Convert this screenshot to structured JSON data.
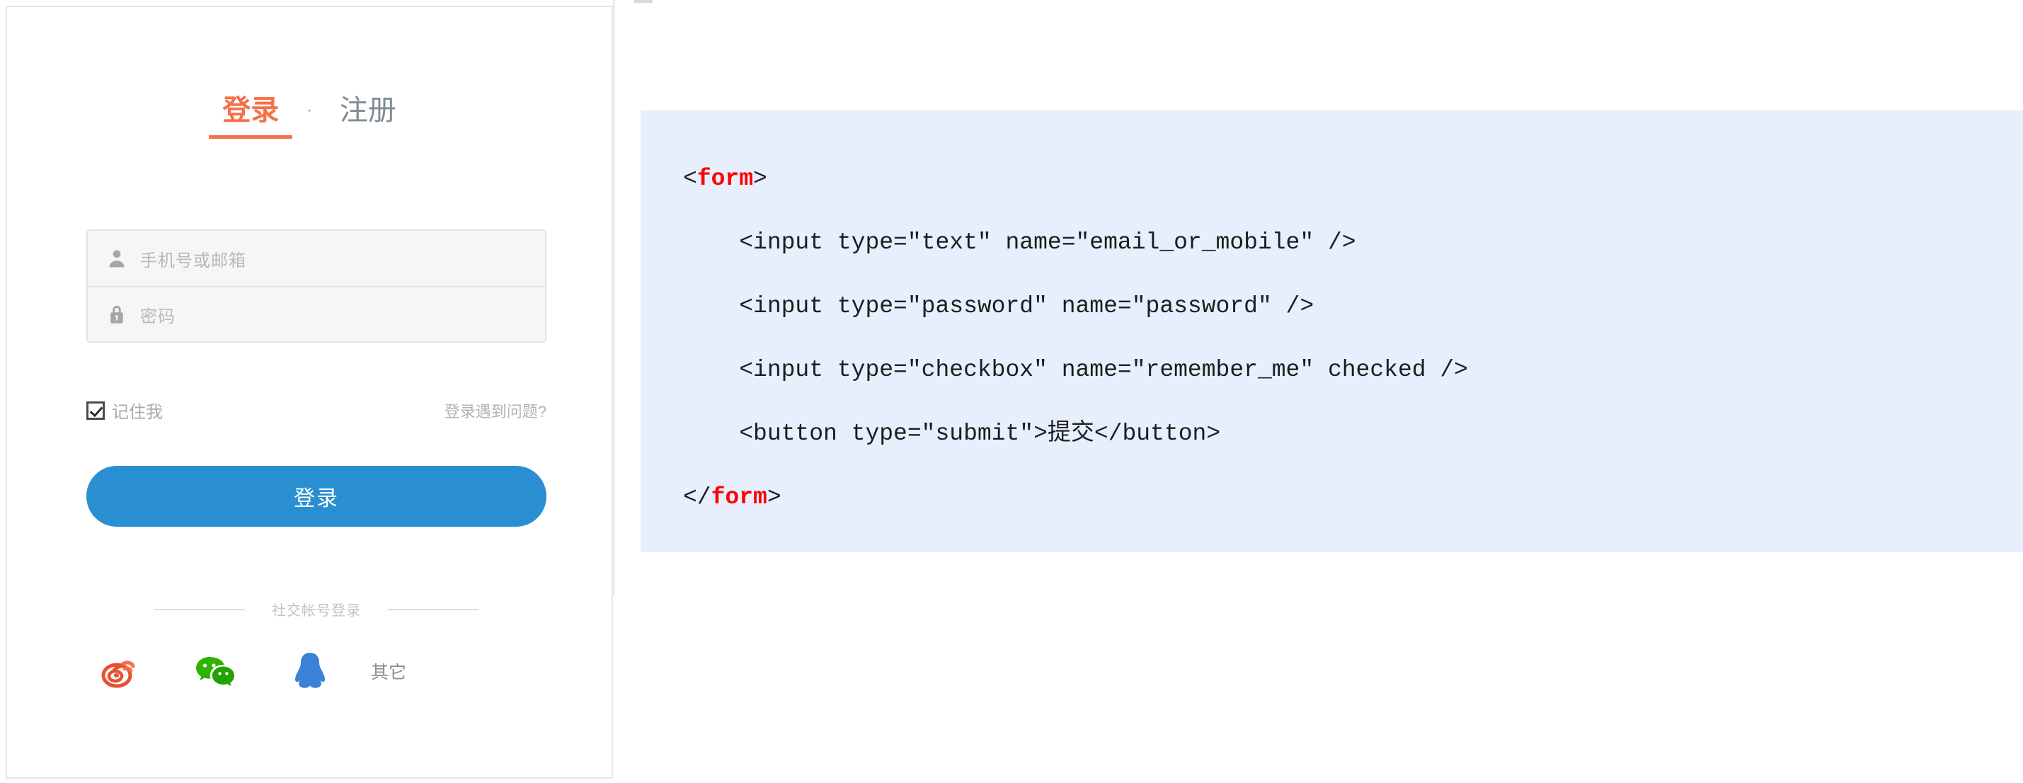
{
  "login_card": {
    "tabs": [
      {
        "label": "登录",
        "active": true,
        "name": "tab-login"
      },
      {
        "label": "注册",
        "active": false,
        "name": "tab-register"
      }
    ],
    "tab_separator": "·",
    "fields": [
      {
        "icon": "user-icon",
        "placeholder": "手机号或邮箱",
        "value": ""
      },
      {
        "icon": "lock-icon",
        "placeholder": "密码",
        "value": ""
      }
    ],
    "remember": {
      "label": "记住我",
      "checked": true
    },
    "help_link": "登录遇到问题?",
    "submit_label": "登录",
    "social": {
      "divider_text": "社交帐号登录",
      "items": [
        {
          "name": "weibo-icon",
          "label": "",
          "color": "#e8502f"
        },
        {
          "name": "wechat-icon",
          "label": "",
          "color": "#2db400"
        },
        {
          "name": "qq-icon",
          "label": "",
          "color": "#3b82d6"
        },
        {
          "name": "other-login",
          "label": "其它",
          "color": "#8d8d8d"
        }
      ]
    }
  },
  "code_block": {
    "background": "#e7effc",
    "tag_color": "#ff0000",
    "lines": [
      {
        "indent": 0,
        "parts": [
          {
            "t": "<"
          },
          {
            "t": "form",
            "tag": true
          },
          {
            "t": ">"
          }
        ]
      },
      {
        "indent": 1,
        "parts": [
          {
            "t": "<input type=\"text\" name=\"email_or_mobile\" />"
          }
        ]
      },
      {
        "indent": 1,
        "parts": [
          {
            "t": "<input type=\"password\" name=\"password\" />"
          }
        ]
      },
      {
        "indent": 1,
        "parts": [
          {
            "t": "<input type=\"checkbox\" name=\"remember_me\" checked />"
          }
        ]
      },
      {
        "indent": 1,
        "parts": [
          {
            "t": "<button type=\"submit\">提交</button>"
          }
        ]
      },
      {
        "indent": 0,
        "parts": [
          {
            "t": "</"
          },
          {
            "t": "form",
            "tag": true
          },
          {
            "t": ">"
          }
        ]
      }
    ]
  }
}
